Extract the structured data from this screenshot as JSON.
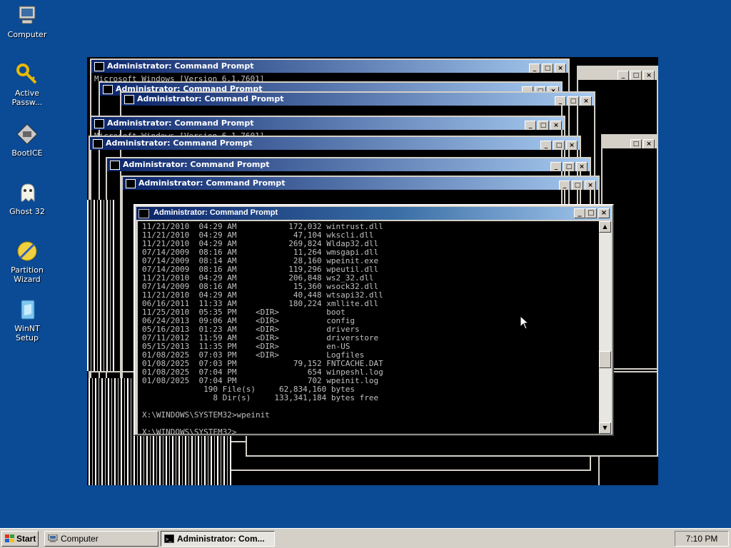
{
  "desktop": {
    "icons": [
      {
        "label": "Computer",
        "icon": "computer-icon"
      },
      {
        "label": "Active Passw...",
        "icon": "key-icon"
      },
      {
        "label": "BootICE",
        "icon": "bootice-icon"
      },
      {
        "label": "Ghost 32",
        "icon": "ghost-icon"
      },
      {
        "label": "Partition Wizard",
        "icon": "partition-wizard-icon"
      },
      {
        "label": "WinNT Setup",
        "icon": "winnt-setup-icon"
      }
    ],
    "background_color": "#0b4a94"
  },
  "ghost_windows": {
    "title": "Administrator: Command Prompt",
    "partial_text_1": "Microsoft Windows [Version 6.1.7601]"
  },
  "window": {
    "title": "Administrator: Command Prompt",
    "minimize_label": "_",
    "maximize_label": "□",
    "close_label": "×",
    "console_lines": [
      "11/21/2010  04:29 AM           172,032 wintrust.dll",
      "11/21/2010  04:29 AM            47,104 wkscli.dll",
      "11/21/2010  04:29 AM           269,824 Wldap32.dll",
      "07/14/2009  08:16 AM            11,264 wmsgapi.dll",
      "07/14/2009  08:14 AM            28,160 wpeinit.exe",
      "07/14/2009  08:16 AM           119,296 wpeutil.dll",
      "11/21/2010  04:29 AM           206,848 ws2_32.dll",
      "07/14/2009  08:16 AM            15,360 wsock32.dll",
      "11/21/2010  04:29 AM            40,448 wtsapi32.dll",
      "06/16/2011  11:33 AM           180,224 xmllite.dll",
      "11/25/2010  05:35 PM    <DIR>          boot",
      "06/24/2013  09:06 AM    <DIR>          config",
      "05/16/2013  01:23 AM    <DIR>          drivers",
      "07/11/2012  11:59 AM    <DIR>          driverstore",
      "05/15/2013  11:35 PM    <DIR>          en-US",
      "01/08/2025  07:03 PM    <DIR>          Logfiles",
      "01/08/2025  07:03 PM            79,152 FNTCACHE.DAT",
      "01/08/2025  07:04 PM               654 winpeshl.log",
      "01/08/2025  07:04 PM               702 wpeinit.log",
      "             190 File(s)     62,834,160 bytes",
      "               8 Dir(s)     133,341,184 bytes free",
      "",
      "X:\\WINDOWS\\SYSTEM32>wpeinit",
      "",
      "X:\\WINDOWS\\SYSTEM32>"
    ]
  },
  "taskbar": {
    "start_label": "Start",
    "items": [
      {
        "label": "Computer",
        "active": false
      },
      {
        "label": "Administrator: Com...",
        "active": true
      }
    ],
    "clock": "7:10 PM"
  }
}
